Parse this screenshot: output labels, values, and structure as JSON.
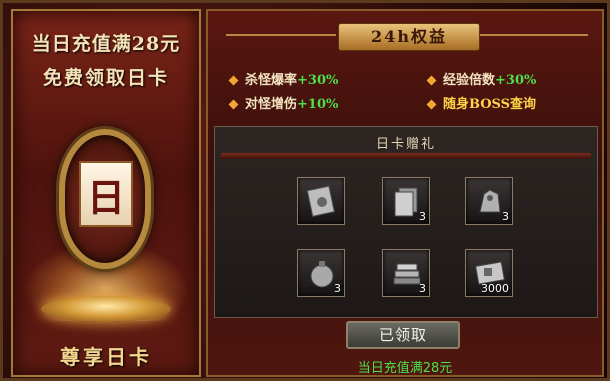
{
  "left": {
    "promo_line1": "当日充值满28元",
    "promo_line2": "免费领取日卡",
    "card_glyph": "日",
    "enjoy_label": "尊享日卡"
  },
  "right": {
    "title": "24h权益",
    "perks": [
      {
        "label": "杀怪爆率",
        "bonus": "+30%"
      },
      {
        "label": "经验倍数",
        "bonus": "+30%"
      },
      {
        "label": "对怪增伤",
        "bonus": "+10%"
      },
      {
        "label": "随身BOSS查询",
        "bonus": ""
      }
    ],
    "gift_header": "日卡赠礼",
    "gifts": [
      {
        "icon": "scroll-card-icon",
        "count": ""
      },
      {
        "icon": "card-stack-icon",
        "count": "3"
      },
      {
        "icon": "beast-figurine-icon",
        "count": "3"
      },
      {
        "icon": "potion-pouch-icon",
        "count": "3"
      },
      {
        "icon": "book-stack-icon",
        "count": "3"
      },
      {
        "icon": "ticket-icon",
        "count": "3000"
      }
    ],
    "claim_button": "已领取",
    "footer_note": "当日充值满28元"
  },
  "colors": {
    "accent_green": "#4de04a",
    "gold": "#f3d78e",
    "perk_yellow": "#ffd24a"
  }
}
